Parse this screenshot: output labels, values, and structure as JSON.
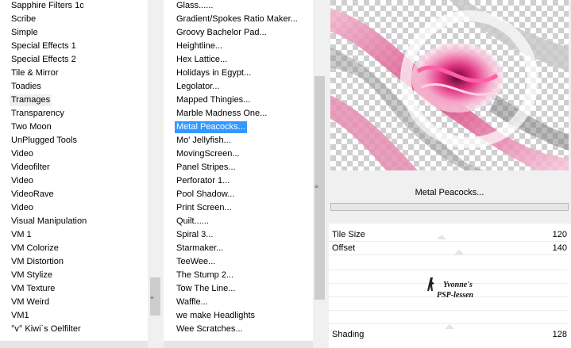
{
  "categories": {
    "items": [
      "Sapphire Filters 1c",
      "Scribe",
      "Simple",
      "Special Effects 1",
      "Special Effects 2",
      "Tile & Mirror",
      "Toadies",
      "Tramages",
      "Transparency",
      "Two Moon",
      "UnPlugged Tools",
      "Video",
      "Videofilter",
      "Video",
      "VideoRave",
      "Video",
      "Visual Manipulation",
      "VM 1",
      "VM Colorize",
      "VM Distortion",
      "VM Stylize",
      "VM Texture",
      "VM Weird",
      "VM1",
      "°v° Kiwi`s Oelfilter"
    ],
    "selected": "Tramages"
  },
  "filters": {
    "items": [
      "Glass......",
      "Gradient/Spokes Ratio Maker...",
      "Groovy Bachelor Pad...",
      "Heightline...",
      "Hex Lattice...",
      "Holidays in Egypt...",
      "Legolator...",
      "Mapped Thingies...",
      "Marble Madness One...",
      "Metal Peacocks...",
      "Mo' Jellyfish...",
      "MovingScreen...",
      "Panel Stripes...",
      "Perforator 1...",
      "Pool Shadow...",
      "Print Screen...",
      "Quilt......",
      "Spiral 3...",
      "Starmaker...",
      "TeeWee...",
      "The Stump 2...",
      "Tow The Line...",
      "Waffle...",
      "we make Headlights",
      "Wee Scratches..."
    ],
    "selected": "Metal Peacocks..."
  },
  "preview": {
    "title": "Metal Peacocks...",
    "progress": 0,
    "accent_color": "#e0307f"
  },
  "params": {
    "tile_size": {
      "label": "Tile Size",
      "value": "120"
    },
    "offset": {
      "label": "Offset",
      "value": "140"
    },
    "shading": {
      "label": "Shading",
      "value": "128"
    }
  },
  "watermark": {
    "line1": "Yvonne's",
    "line2": "PSP-lessen"
  },
  "icons": {
    "scroll_grip": "grip-lines-icon"
  }
}
